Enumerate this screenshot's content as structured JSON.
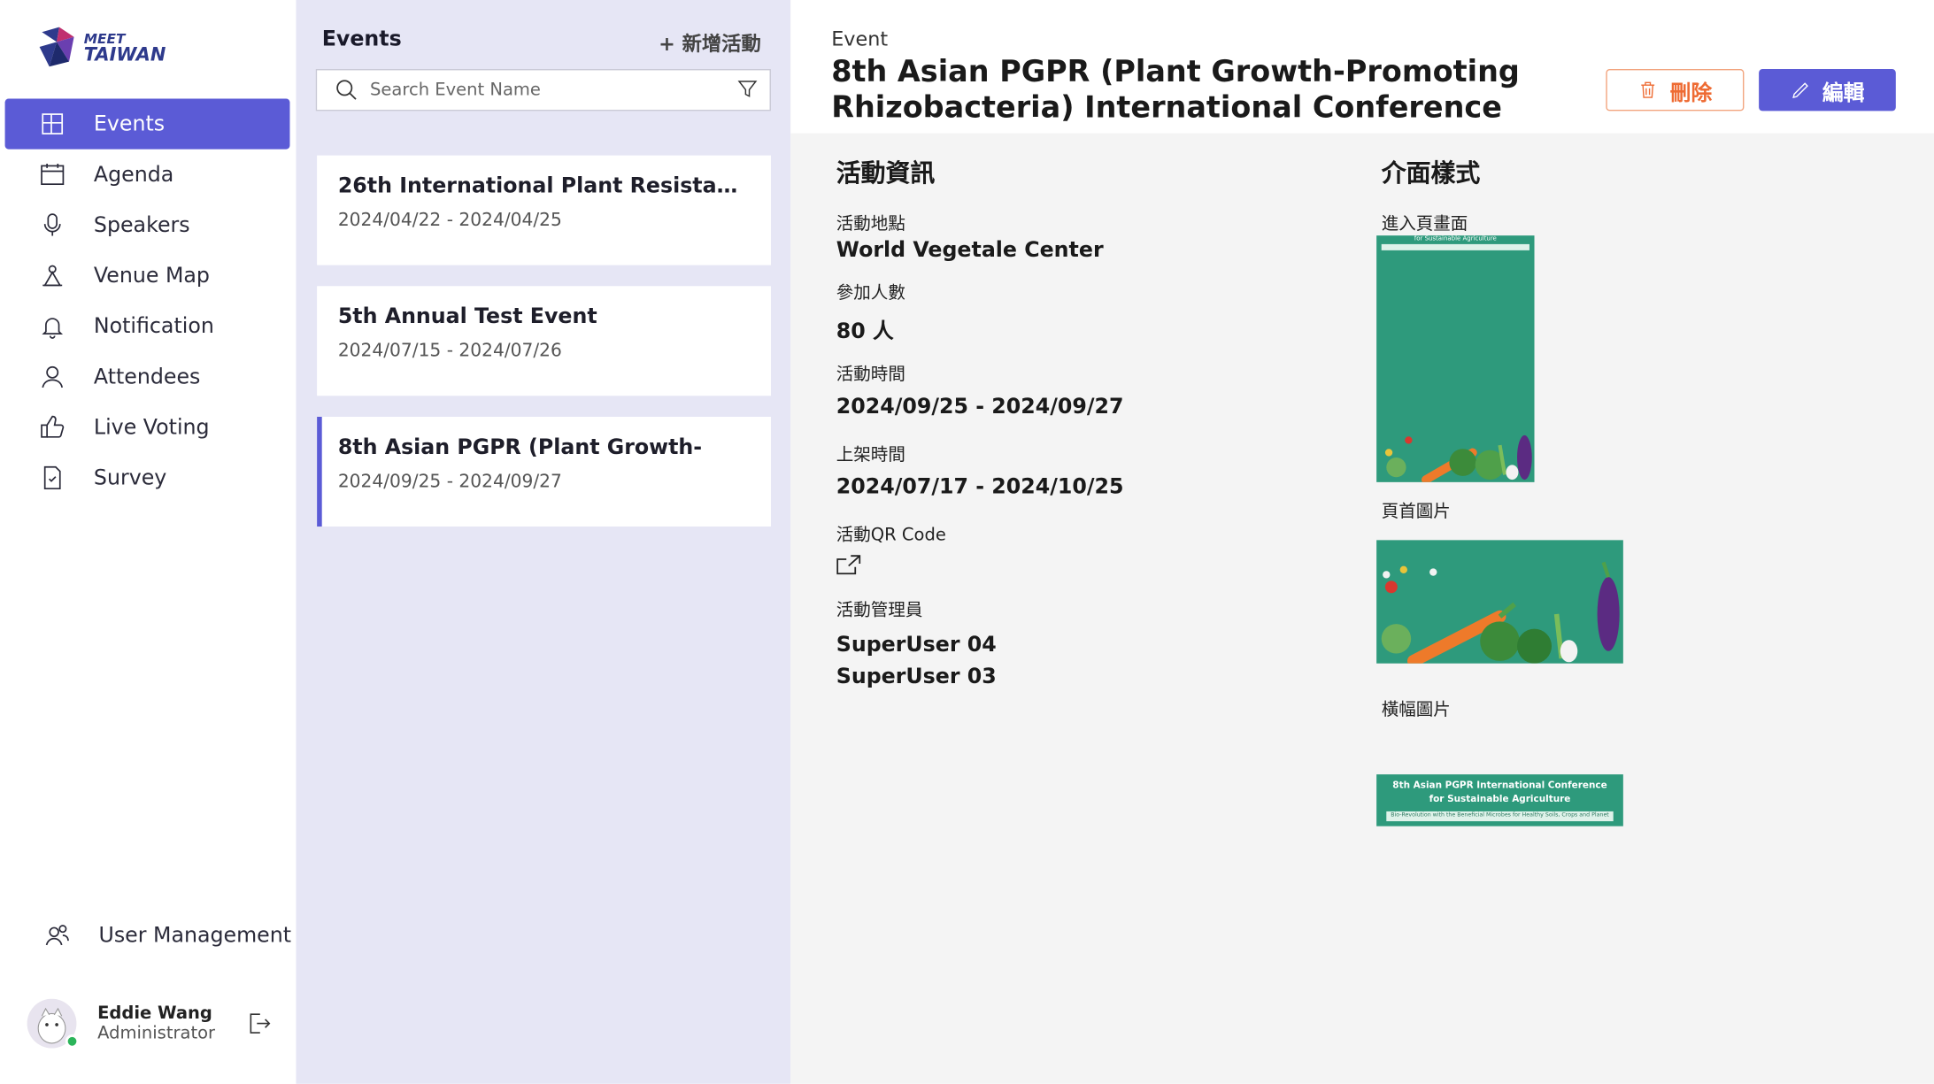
{
  "brand": {
    "line1": "MEET",
    "line2": "TAIWAN"
  },
  "nav": {
    "items": [
      {
        "label": "Events",
        "icon": "events-grid-icon"
      },
      {
        "label": "Agenda",
        "icon": "calendar-icon"
      },
      {
        "label": "Speakers",
        "icon": "microphone-icon"
      },
      {
        "label": "Venue Map",
        "icon": "map-pin-icon"
      },
      {
        "label": "Notification",
        "icon": "bell-icon"
      },
      {
        "label": "Attendees",
        "icon": "person-icon"
      },
      {
        "label": "Live Voting",
        "icon": "thumbs-up-icon"
      },
      {
        "label": "Survey",
        "icon": "document-check-icon"
      }
    ],
    "user_management": "User Management"
  },
  "user": {
    "name": "Eddie Wang",
    "role": "Administrator",
    "status_color": "#2bb45a"
  },
  "list": {
    "title": "Events",
    "add_label": "+ 新增活動",
    "search_placeholder": "Search Event Name",
    "events": [
      {
        "title": "26th International Plant Resistance...",
        "dates": "2024/04/22 - 2024/04/25"
      },
      {
        "title": "5th Annual Test Event",
        "dates": "2024/07/15 - 2024/07/26"
      },
      {
        "title": "8th Asian PGPR (Plant Growth-",
        "dates": "2024/09/25 - 2024/09/27"
      }
    ]
  },
  "detail": {
    "eyebrow": "Event",
    "title": "8th Asian PGPR (Plant Growth-Promoting Rhizobacteria) International Conference",
    "delete_label": "刪除",
    "edit_label": "編輯",
    "info_section": "活動資訊",
    "location_label": "活動地點",
    "location": "World Vegetale Center",
    "attendees_label": "參加人數",
    "attendees": "80 人",
    "event_time_label": "活動時間",
    "event_time": "2024/09/25 - 2024/09/27",
    "publish_time_label": "上架時間",
    "publish_time": "2024/07/17 - 2024/10/25",
    "qr_label": "活動QR Code",
    "admins_label": "活動管理員",
    "admins": [
      "SuperUser 04",
      "SuperUser 03"
    ],
    "style_section": "介面樣式",
    "enter_page_label": "進入頁畫面",
    "header_image_label": "頁首圖片",
    "banner_image_label": "橫幅圖片",
    "banner_line1": "8th Asian PGPR International Conference",
    "banner_line2": "for Sustainable Agriculture",
    "banner_line3": "Bio-Revolution with the Beneficial Microbes for Healthy Soils, Crops and Planet",
    "enter_page_caption": "for Sustainable Agriculture"
  },
  "colors": {
    "accent": "#5b5bd6",
    "danger": "#ee6b33",
    "banner_green": "#2e9a7c",
    "list_bg": "#e6e6f5"
  }
}
